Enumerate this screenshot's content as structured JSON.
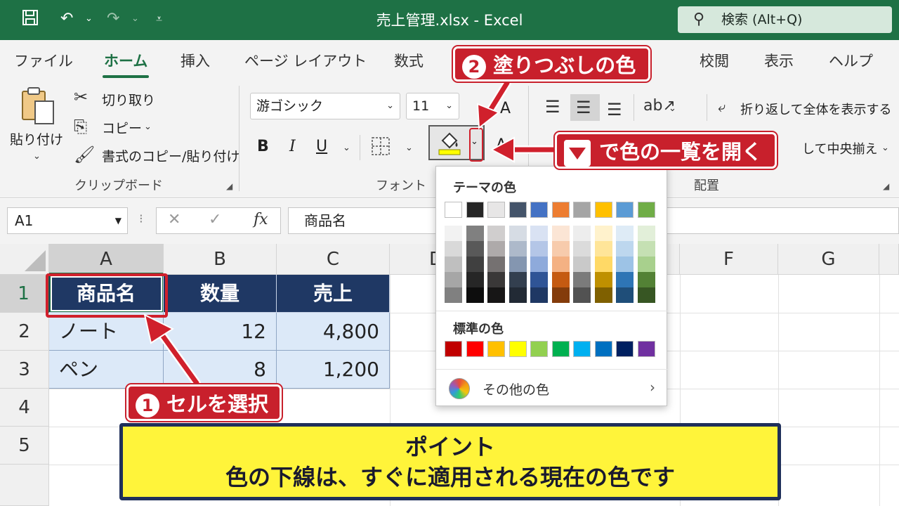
{
  "window": {
    "title": "売上管理.xlsx  -  Excel",
    "search_label": "検索 (Alt+Q)"
  },
  "menu": {
    "tabs": [
      {
        "label": "ファイル"
      },
      {
        "label": "ホーム"
      },
      {
        "label": "挿入"
      },
      {
        "label": "ページ レイアウト"
      },
      {
        "label": "数式"
      },
      {
        "label": "校閲"
      },
      {
        "label": "表示"
      },
      {
        "label": "ヘルプ"
      }
    ]
  },
  "ribbon": {
    "clipboard": {
      "paste": "貼り付け",
      "cut": "切り取り",
      "copy": "コピー",
      "format_painter": "書式のコピー/貼り付け",
      "group_label": "クリップボード"
    },
    "font": {
      "font_name": "游ゴシック",
      "font_size": "11",
      "bold": "B",
      "italic": "I",
      "underline": "U",
      "font_color_letter": "A",
      "grow_letter": "A",
      "group_label": "フォント"
    },
    "alignment": {
      "wrap_text": "折り返して全体を表示する",
      "merge_center": "して中央揃え",
      "group_label": "配置"
    }
  },
  "formula_bar": {
    "name_box": "A1",
    "fx": "fx",
    "value": "商品名"
  },
  "grid": {
    "columns": [
      "A",
      "B",
      "C",
      "D",
      "E",
      "F",
      "G"
    ],
    "rows": [
      "1",
      "2",
      "3",
      "4",
      "5"
    ],
    "cells": {
      "header": [
        "商品名",
        "数量",
        "売上"
      ],
      "row2": [
        "ノート",
        "12",
        "4,800"
      ],
      "row3": [
        "ペン",
        "8",
        "1,200"
      ]
    }
  },
  "palette": {
    "theme_title": "テーマの色",
    "standard_title": "標準の色",
    "more_colors": "その他の色",
    "theme_colors": [
      "#ffffff",
      "#262626",
      "#e7e6e6",
      "#44546a",
      "#4472c4",
      "#ed7d31",
      "#a5a5a5",
      "#ffc000",
      "#5b9bd5",
      "#70ad47"
    ],
    "theme_tints": [
      [
        "#f2f2f2",
        "#d9d9d9",
        "#bfbfbf",
        "#a6a6a6",
        "#808080"
      ],
      [
        "#808080",
        "#595959",
        "#404040",
        "#262626",
        "#0d0d0d"
      ],
      [
        "#d0cece",
        "#aeaaaa",
        "#757171",
        "#3a3838",
        "#171616"
      ],
      [
        "#d6dce4",
        "#adb9ca",
        "#8496b0",
        "#333f4f",
        "#222a35"
      ],
      [
        "#d9e2f3",
        "#b4c6e7",
        "#8eaadb",
        "#2f5496",
        "#1f3864"
      ],
      [
        "#fbe5d5",
        "#f7cbac",
        "#f4b183",
        "#c55a11",
        "#843c0b"
      ],
      [
        "#ededed",
        "#dbdbdb",
        "#c9c9c9",
        "#7b7b7b",
        "#525252"
      ],
      [
        "#fff2cc",
        "#ffe599",
        "#ffd966",
        "#bf9000",
        "#7f6000"
      ],
      [
        "#deebf6",
        "#bdd7ee",
        "#9dc3e6",
        "#2e75b5",
        "#1f4e79"
      ],
      [
        "#e2efd9",
        "#c5e0b3",
        "#a8d08d",
        "#538135",
        "#375623"
      ]
    ],
    "standard_colors": [
      "#c00000",
      "#ff0000",
      "#ffc000",
      "#ffff00",
      "#92d050",
      "#00b050",
      "#00b0f0",
      "#0070c0",
      "#002060",
      "#7030a0"
    ]
  },
  "annotations": {
    "step1": {
      "number": "1",
      "text": "セルを選択"
    },
    "step2": {
      "number": "2",
      "text": "塗りつぶしの色"
    },
    "open_list": "で色の一覧を開く",
    "point_title": "ポイント",
    "point_body": "色の下線は、すぐに適用される現在の色です"
  },
  "colors": {
    "excel_green": "#1e7145",
    "table_header": "#1f3864",
    "table_body": "#dce9f8",
    "callout_red": "#c8202c",
    "point_yellow": "#fff43a"
  }
}
